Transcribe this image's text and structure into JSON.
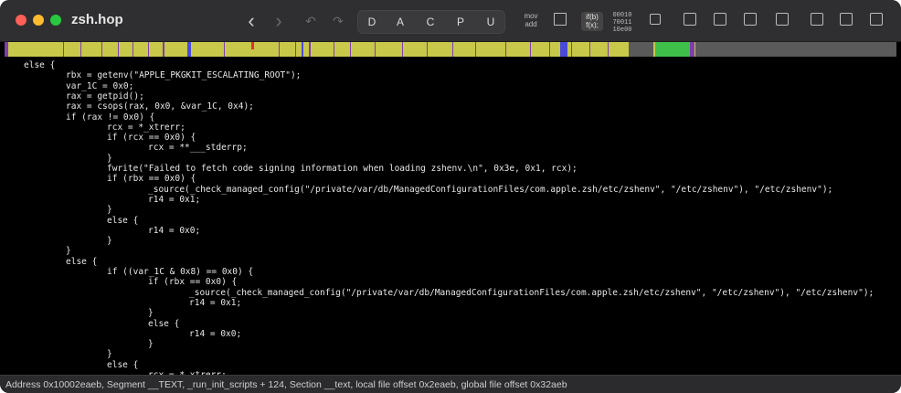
{
  "window": {
    "title": "zsh.hop"
  },
  "toolbar": {
    "nav_back": "‹",
    "nav_forward": "›",
    "undo": "↶",
    "redo": "↷",
    "modes": [
      "D",
      "A",
      "C",
      "P",
      "U"
    ],
    "mov_add_label_1": "mov",
    "mov_add_label_2": "add",
    "if_label_1": "if(b)",
    "if_label_2": "f(x);",
    "hex_label_1": "00010",
    "hex_label_2": "70011",
    "hex_label_3": "10e00"
  },
  "navbar": {
    "colors": {
      "code": "#c8c84a",
      "data": "#7d3fae",
      "string": "#4a4ad8",
      "green": "#3fc04a",
      "unexplored": "#5a5a5a",
      "marker": "#e03030"
    }
  },
  "code_lines": [
    {
      "indent": 0,
      "text": "else {"
    },
    {
      "indent": 1,
      "text": "rbx = getenv(\"APPLE_PKGKIT_ESCALATING_ROOT\");"
    },
    {
      "indent": 1,
      "text": "var_1C = 0x0;"
    },
    {
      "indent": 1,
      "text": "rax = getpid();"
    },
    {
      "indent": 1,
      "text": "rax = csops(rax, 0x0, &var_1C, 0x4);"
    },
    {
      "indent": 1,
      "text": "if (rax != 0x0) {"
    },
    {
      "indent": 2,
      "text": "rcx = *_xtrerr;"
    },
    {
      "indent": 2,
      "text": "if (rcx == 0x0) {"
    },
    {
      "indent": 3,
      "text": "rcx = **___stderrp;"
    },
    {
      "indent": 2,
      "text": "}"
    },
    {
      "indent": 2,
      "text": "fwrite(\"Failed to fetch code signing information when loading zshenv.\\n\", 0x3e, 0x1, rcx);"
    },
    {
      "indent": 2,
      "text": "if (rbx == 0x0) {"
    },
    {
      "indent": 3,
      "text": "_source(_check_managed_config(\"/private/var/db/ManagedConfigurationFiles/com.apple.zsh/etc/zshenv\", \"/etc/zshenv\"), \"/etc/zshenv\");"
    },
    {
      "indent": 3,
      "text": "r14 = 0x1;"
    },
    {
      "indent": 2,
      "text": "}"
    },
    {
      "indent": 2,
      "text": "else {"
    },
    {
      "indent": 3,
      "text": "r14 = 0x0;"
    },
    {
      "indent": 2,
      "text": "}"
    },
    {
      "indent": 1,
      "text": "}"
    },
    {
      "indent": 1,
      "text": "else {"
    },
    {
      "indent": 2,
      "text": "if ((var_1C & 0x8) == 0x0) {"
    },
    {
      "indent": 3,
      "text": "if (rbx == 0x0) {"
    },
    {
      "indent": 4,
      "text": "_source(_check_managed_config(\"/private/var/db/ManagedConfigurationFiles/com.apple.zsh/etc/zshenv\", \"/etc/zshenv\"), \"/etc/zshenv\");"
    },
    {
      "indent": 4,
      "text": "r14 = 0x1;"
    },
    {
      "indent": 3,
      "text": "}"
    },
    {
      "indent": 3,
      "text": "else {"
    },
    {
      "indent": 4,
      "text": "r14 = 0x0;"
    },
    {
      "indent": 3,
      "text": "}"
    },
    {
      "indent": 2,
      "text": "}"
    },
    {
      "indent": 2,
      "text": "else {"
    },
    {
      "indent": 3,
      "text": "rcx = *_xtrerr;"
    }
  ],
  "statusbar": {
    "text": "Address 0x10002eaeb, Segment __TEXT, _run_init_scripts + 124, Section __text, local file offset 0x2eaeb, global file offset 0x32aeb"
  }
}
